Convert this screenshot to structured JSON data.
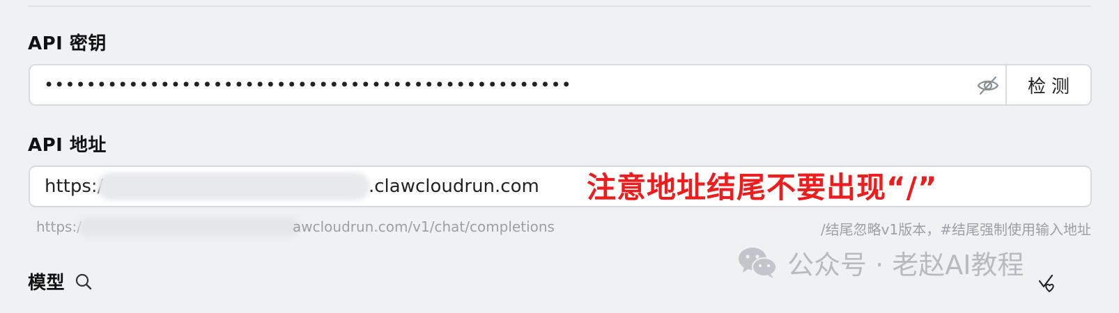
{
  "api_key": {
    "label": "API 密钥",
    "masked_value": "••••••••••••••••••••••••••••••••••••••••••••••••••",
    "toggle_icon": "eye-off-icon",
    "check_button": "检测"
  },
  "api_url": {
    "label": "API 地址",
    "value_prefix": "https:/",
    "value_suffix": ".clawcloudrun.com",
    "annotation": "注意地址结尾不要出现“/”",
    "annotation_color": "#ee1c1c",
    "hint_prefix": "https:/",
    "hint_suffix": "awcloudrun.com/v1/chat/completions",
    "hint_right": "/结尾忽略v1版本，#结尾强制使用输入地址"
  },
  "model": {
    "label": "模型",
    "search_icon": "search-icon",
    "action_icon": "select-check-icon"
  },
  "watermark": {
    "icon": "wechat-icon",
    "text": "公众号 · 老赵AI教程"
  }
}
